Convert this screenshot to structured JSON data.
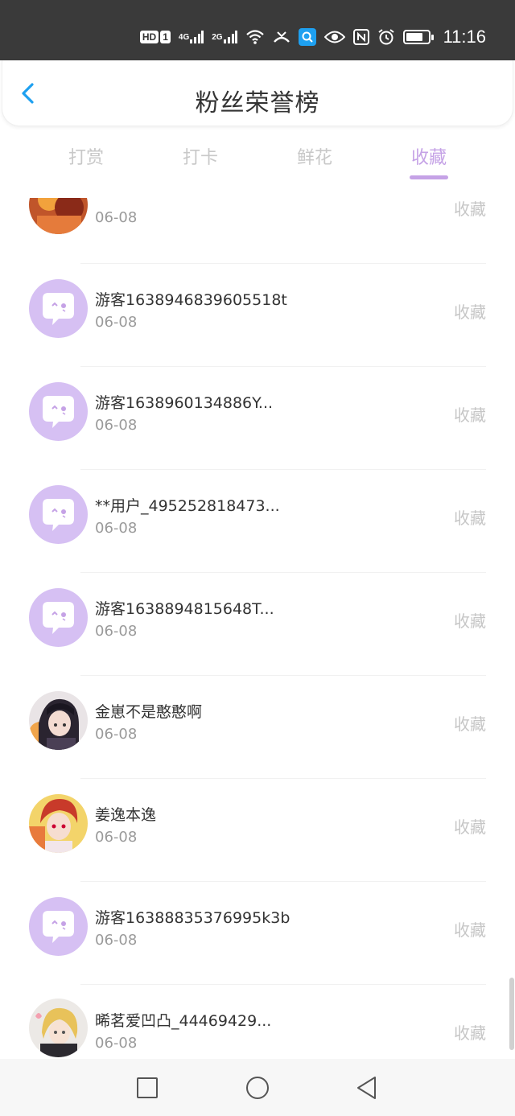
{
  "status_bar": {
    "hd_badge": "HD",
    "sim_badge": "1",
    "net1": "4G",
    "net2": "2G",
    "time": "11:16",
    "battery_level": 0.75
  },
  "header": {
    "title": "粉丝荣誉榜"
  },
  "tabs": [
    {
      "label": "打赏",
      "active": false
    },
    {
      "label": "打卡",
      "active": false
    },
    {
      "label": "鲜花",
      "active": false
    },
    {
      "label": "收藏",
      "active": true
    }
  ],
  "list": [
    {
      "name": "",
      "date": "06-08",
      "action": "收藏",
      "avatar": "photo-red-icon"
    },
    {
      "name": "游客1638946839605518t",
      "date": "06-08",
      "action": "收藏",
      "avatar": "default-chat-avatar-icon"
    },
    {
      "name": "游客1638960134886Y...",
      "date": "06-08",
      "action": "收藏",
      "avatar": "default-chat-avatar-icon"
    },
    {
      "name": "**用户_495252818473...",
      "date": "06-08",
      "action": "收藏",
      "avatar": "default-chat-avatar-icon"
    },
    {
      "name": "游客1638894815648T...",
      "date": "06-08",
      "action": "收藏",
      "avatar": "default-chat-avatar-icon"
    },
    {
      "name": "金崽不是憨憨啊",
      "date": "06-08",
      "action": "收藏",
      "avatar": "anime-dark-avatar-icon"
    },
    {
      "name": "姜逸本逸",
      "date": "06-08",
      "action": "收藏",
      "avatar": "anime-red-avatar-icon"
    },
    {
      "name": "游客16388835376995k3b",
      "date": "06-08",
      "action": "收藏",
      "avatar": "default-chat-avatar-icon"
    },
    {
      "name": "晞茗爱凹凸_44469429...",
      "date": "06-08",
      "action": "收藏",
      "avatar": "anime-blond-avatar-icon"
    }
  ],
  "colors": {
    "accent": "#c5a2e6",
    "default_avatar_bg": "#d6c0f3",
    "back_arrow": "#1ea0f0"
  }
}
